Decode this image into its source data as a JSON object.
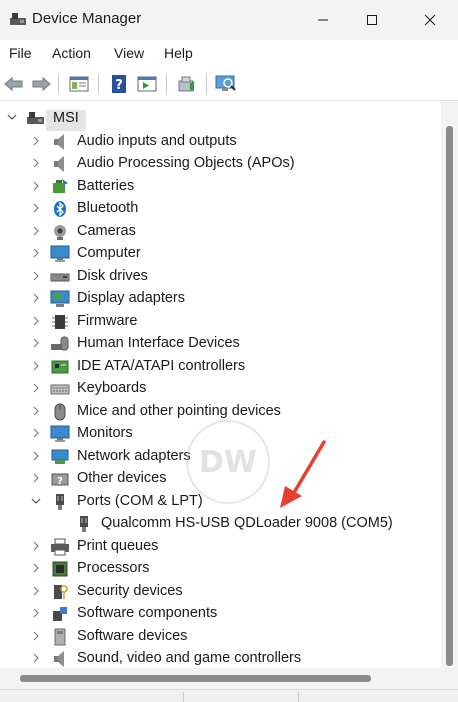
{
  "window": {
    "title": "Device Manager",
    "controls": {
      "minimize": "minimize",
      "maximize": "maximize",
      "close": "close"
    }
  },
  "menu": {
    "items": [
      "File",
      "Action",
      "View",
      "Help"
    ]
  },
  "toolbar": {
    "buttons": [
      "back-icon",
      "forward-icon",
      "show-hide-tree-icon",
      "help-icon",
      "action-pane-icon",
      "update-driver-icon",
      "scan-hardware-icon"
    ]
  },
  "tree": {
    "root": "MSI",
    "categories": [
      {
        "label": "Audio inputs and outputs",
        "icon": "speaker-icon",
        "expanded": false
      },
      {
        "label": "Audio Processing Objects (APOs)",
        "icon": "speaker-icon",
        "expanded": false
      },
      {
        "label": "Batteries",
        "icon": "battery-icon",
        "expanded": false
      },
      {
        "label": "Bluetooth",
        "icon": "bluetooth-icon",
        "expanded": false
      },
      {
        "label": "Cameras",
        "icon": "camera-icon",
        "expanded": false
      },
      {
        "label": "Computer",
        "icon": "monitor-icon",
        "expanded": false
      },
      {
        "label": "Disk drives",
        "icon": "disk-icon",
        "expanded": false
      },
      {
        "label": "Display adapters",
        "icon": "display-adapter-icon",
        "expanded": false
      },
      {
        "label": "Firmware",
        "icon": "chip-icon",
        "expanded": false
      },
      {
        "label": "Human Interface Devices",
        "icon": "hid-icon",
        "expanded": false
      },
      {
        "label": "IDE ATA/ATAPI controllers",
        "icon": "controller-icon",
        "expanded": false
      },
      {
        "label": "Keyboards",
        "icon": "keyboard-icon",
        "expanded": false
      },
      {
        "label": "Mice and other pointing devices",
        "icon": "mouse-icon",
        "expanded": false
      },
      {
        "label": "Monitors",
        "icon": "monitor-icon",
        "expanded": false
      },
      {
        "label": "Network adapters",
        "icon": "network-icon",
        "expanded": false
      },
      {
        "label": "Other devices",
        "icon": "unknown-device-icon",
        "expanded": false
      },
      {
        "label": "Ports (COM & LPT)",
        "icon": "port-icon",
        "expanded": true,
        "children": [
          "Qualcomm HS-USB QDLoader 9008 (COM5)"
        ]
      },
      {
        "label": "Print queues",
        "icon": "printer-icon",
        "expanded": false
      },
      {
        "label": "Processors",
        "icon": "processor-icon",
        "expanded": false
      },
      {
        "label": "Security devices",
        "icon": "security-icon",
        "expanded": false
      },
      {
        "label": "Software components",
        "icon": "puzzle-icon",
        "expanded": false
      },
      {
        "label": "Software devices",
        "icon": "software-device-icon",
        "expanded": false
      },
      {
        "label": "Sound, video and game controllers",
        "icon": "speaker-icon",
        "expanded": false
      }
    ]
  },
  "watermark": "DW",
  "colors": {
    "accent": "#0067c0",
    "selection": "#e5e5e5",
    "annotation_arrow": "#e8402f"
  }
}
